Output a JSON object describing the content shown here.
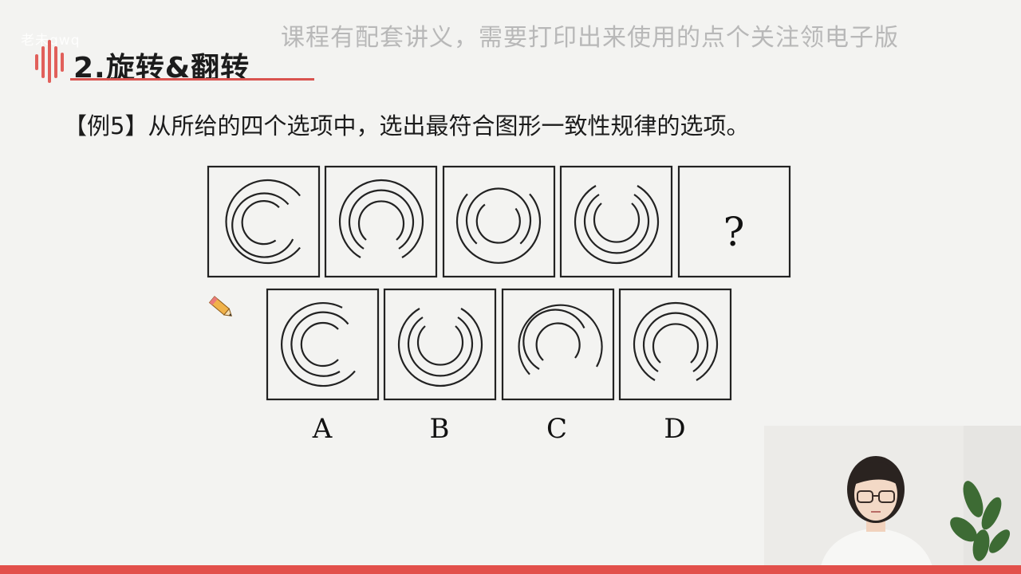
{
  "overlay": {
    "top_left_watermark": "老未qwq",
    "banner": "课程有配套讲义，需要打印出来使用的点个关注领电子版"
  },
  "slide": {
    "section_title": "2.旋转&翻转",
    "question": "【例5】从所给的四个选项中，选出最符合图形一致性规律的选项。",
    "question_mark": "?",
    "options": [
      "A",
      "B",
      "C",
      "D"
    ]
  },
  "colors": {
    "accent": "#d9534f",
    "bottom_bar": "#e2504b",
    "line": "#222222"
  },
  "icons": [
    "logo-icon",
    "pencil-icon"
  ],
  "presenter": {
    "video_visible": true
  }
}
